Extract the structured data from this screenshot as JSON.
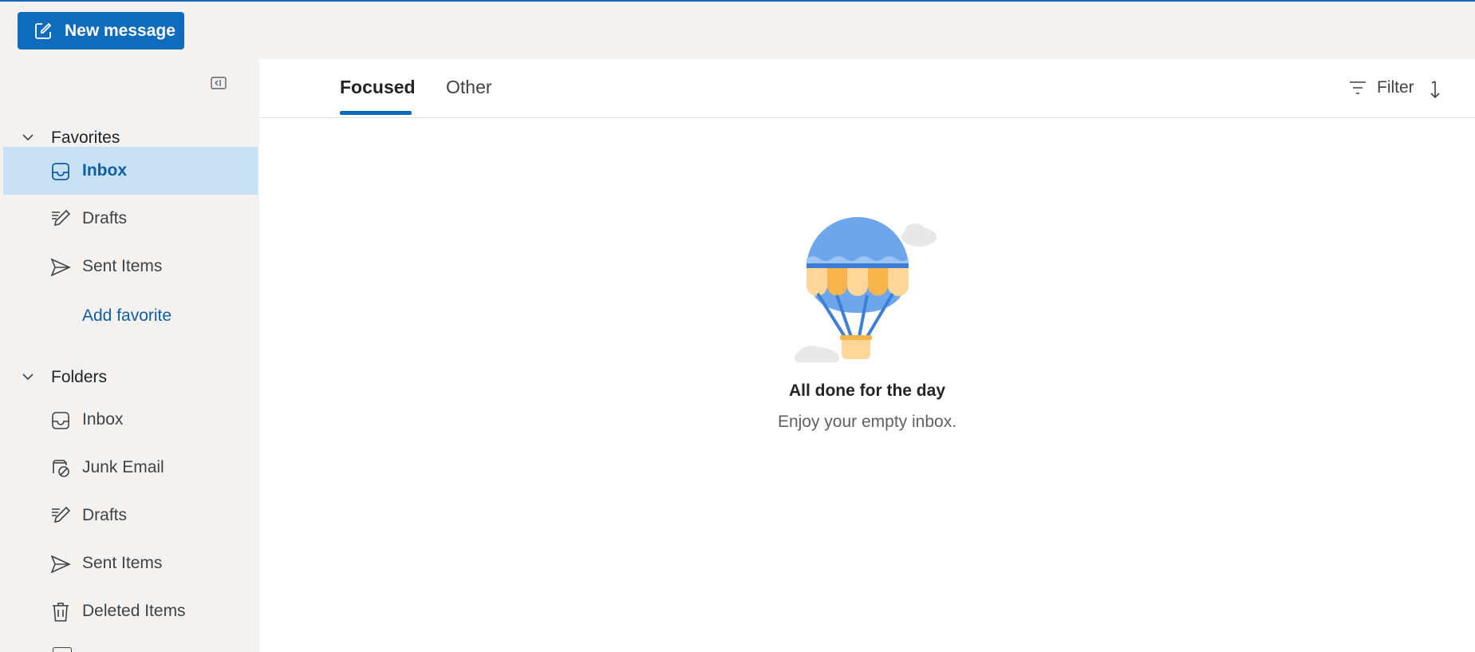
{
  "toolbar": {
    "new_message_label": "New message"
  },
  "sidebar": {
    "favorites": {
      "header": "Favorites",
      "items": [
        {
          "label": "Inbox",
          "icon": "inbox-icon",
          "selected": true
        },
        {
          "label": "Drafts",
          "icon": "drafts-icon",
          "selected": false
        },
        {
          "label": "Sent Items",
          "icon": "sent-icon",
          "selected": false
        }
      ],
      "add_favorite_label": "Add favorite"
    },
    "folders": {
      "header": "Folders",
      "items": [
        {
          "label": "Inbox",
          "icon": "inbox-icon"
        },
        {
          "label": "Junk Email",
          "icon": "junk-icon"
        },
        {
          "label": "Drafts",
          "icon": "drafts-icon"
        },
        {
          "label": "Sent Items",
          "icon": "sent-icon"
        },
        {
          "label": "Deleted Items",
          "icon": "trash-icon"
        }
      ]
    }
  },
  "main": {
    "tabs": [
      {
        "label": "Focused",
        "active": true
      },
      {
        "label": "Other",
        "active": false
      }
    ],
    "filter_label": "Filter",
    "empty_state": {
      "title": "All done for the day",
      "subtitle": "Enjoy your empty inbox."
    }
  },
  "colors": {
    "accent": "#0f6cbd",
    "selected_bg": "#c7e0f4",
    "selected_text": "#115ea3"
  }
}
